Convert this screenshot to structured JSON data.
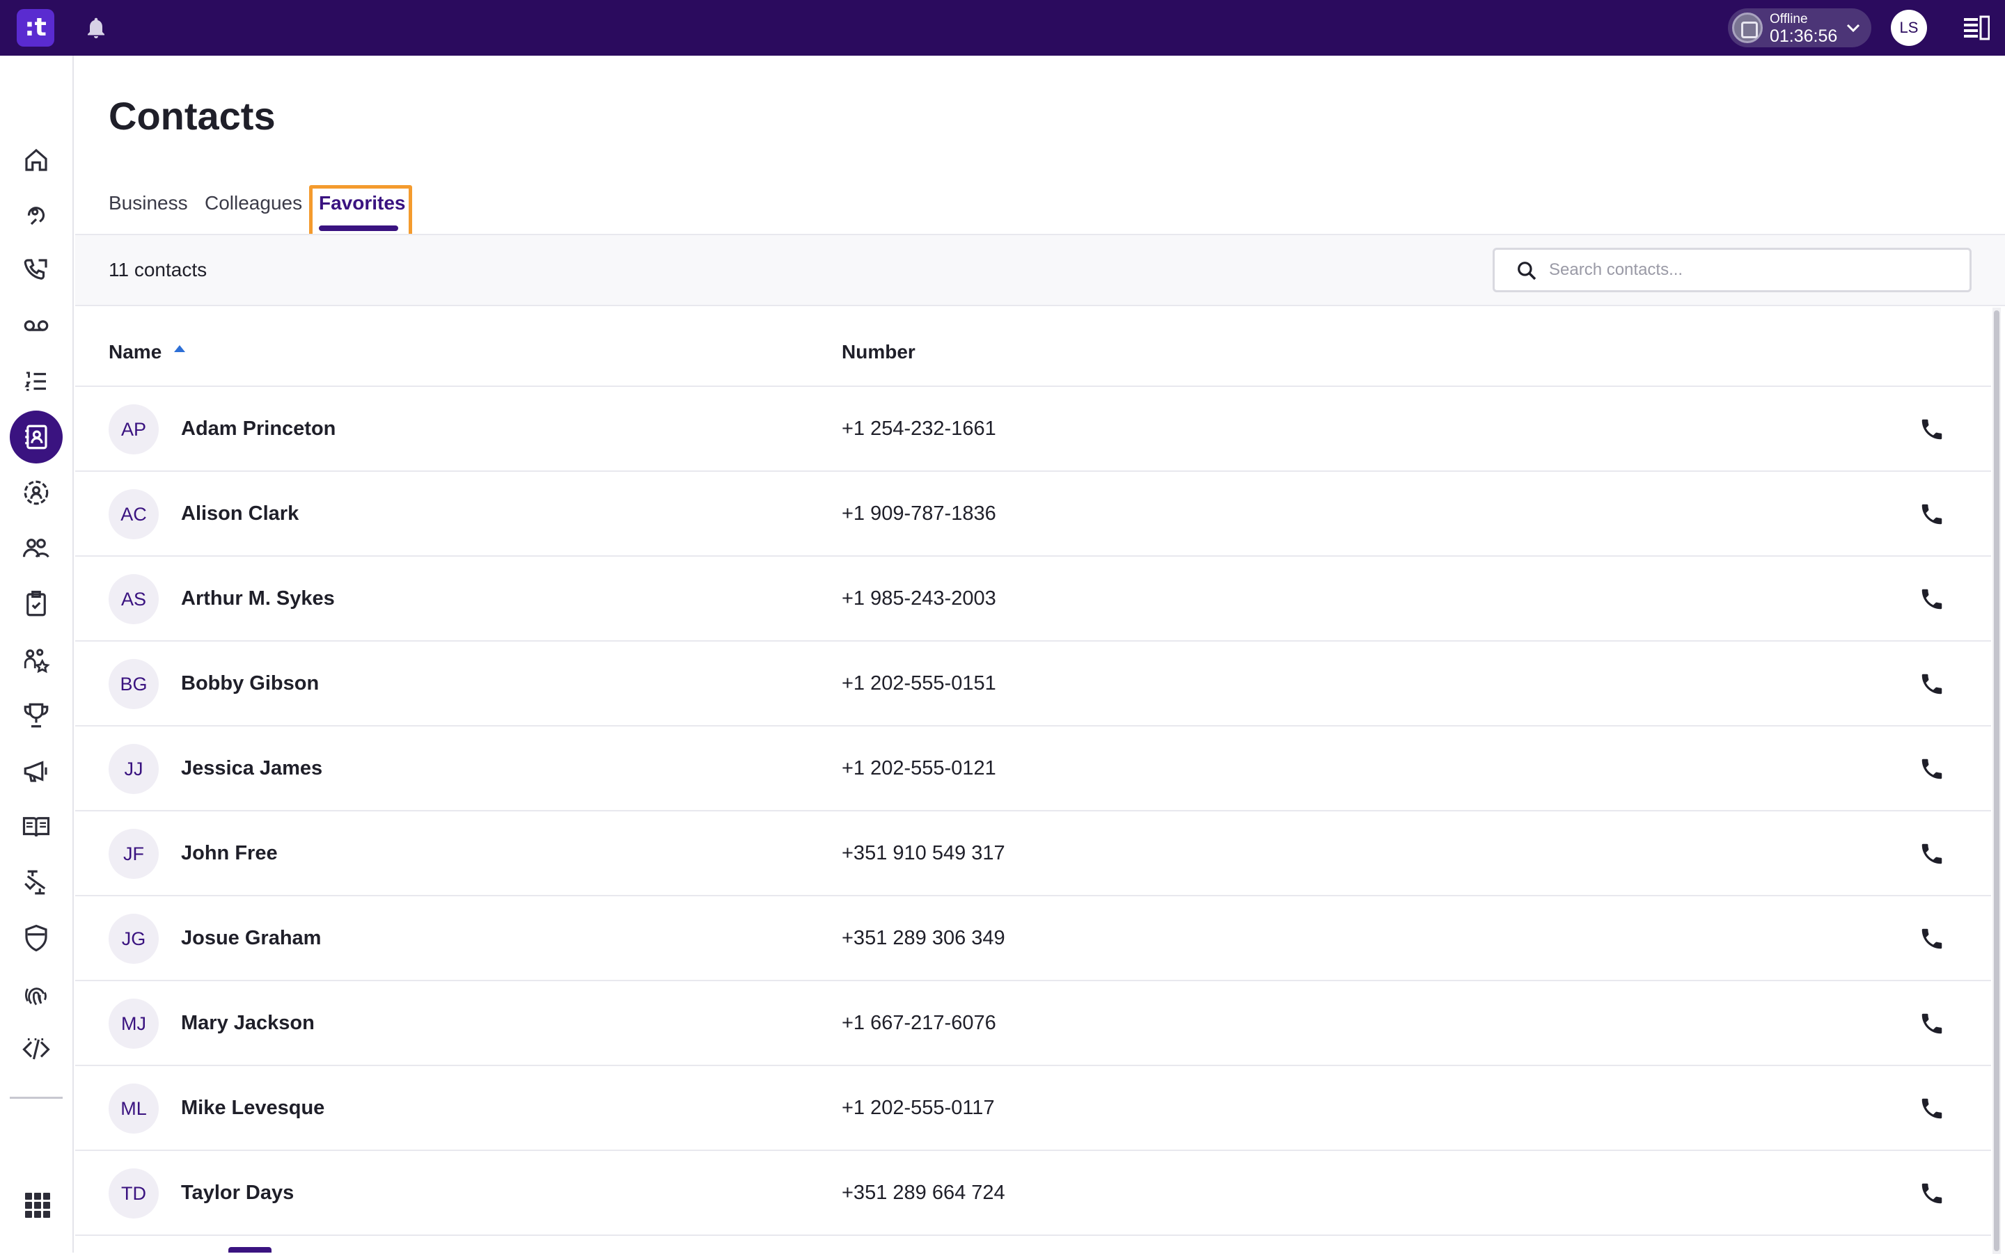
{
  "topbar": {
    "logo_text": ":t",
    "status_label": "Offline",
    "status_time": "01:36:56",
    "user_initials": "LS",
    "background": "#2b0b5e"
  },
  "sidebar": {
    "items": [
      {
        "icon": "home-icon"
      },
      {
        "icon": "contact-center-icon"
      },
      {
        "icon": "call-history-icon"
      },
      {
        "icon": "voicemail-icon"
      },
      {
        "icon": "activity-list-icon"
      },
      {
        "icon": "contacts-book-icon",
        "active": true
      },
      {
        "icon": "agent-status-icon"
      },
      {
        "icon": "teams-icon"
      },
      {
        "icon": "tasks-clipboard-icon"
      },
      {
        "icon": "team-skills-icon"
      },
      {
        "icon": "trophy-icon"
      },
      {
        "icon": "campaigns-megaphone-icon"
      },
      {
        "icon": "knowledge-book-icon"
      },
      {
        "icon": "flows-icon"
      },
      {
        "icon": "security-shield-icon"
      },
      {
        "icon": "fingerprint-icon"
      },
      {
        "icon": "developer-code-icon"
      }
    ],
    "more_label": "...",
    "apps_icon": "apps-grid-icon"
  },
  "page": {
    "title": "Contacts",
    "tabs": [
      {
        "label": "Business",
        "active": false
      },
      {
        "label": "Colleagues",
        "active": false
      },
      {
        "label": "Favorites",
        "active": true
      }
    ],
    "count_text": "11 contacts",
    "search_placeholder": "Search contacts..."
  },
  "table": {
    "columns": [
      "Name",
      "Number"
    ],
    "sort_column": "Name",
    "sort_direction": "ascending",
    "rows": [
      {
        "initials": "AP",
        "name": "Adam Princeton",
        "number": "+1 254-232-1661"
      },
      {
        "initials": "AC",
        "name": "Alison Clark",
        "number": "+1 909-787-1836"
      },
      {
        "initials": "AS",
        "name": "Arthur M. Sykes",
        "number": "+1 985-243-2003"
      },
      {
        "initials": "BG",
        "name": "Bobby Gibson",
        "number": "+1 202-555-0151"
      },
      {
        "initials": "JJ",
        "name": "Jessica James",
        "number": "+1 202-555-0121"
      },
      {
        "initials": "JF",
        "name": "John Free",
        "number": "+351 910 549 317"
      },
      {
        "initials": "JG",
        "name": "Josue Graham",
        "number": "+351 289 306 349"
      },
      {
        "initials": "MJ",
        "name": "Mary Jackson",
        "number": "+1 667-217-6076"
      },
      {
        "initials": "ML",
        "name": "Mike Levesque",
        "number": "+1 202-555-0117"
      },
      {
        "initials": "TD",
        "name": "Taylor Days",
        "number": "+351 289 664 724"
      }
    ]
  },
  "colors": {
    "accent": "#3a1380",
    "highlight": "#f49b2e"
  }
}
